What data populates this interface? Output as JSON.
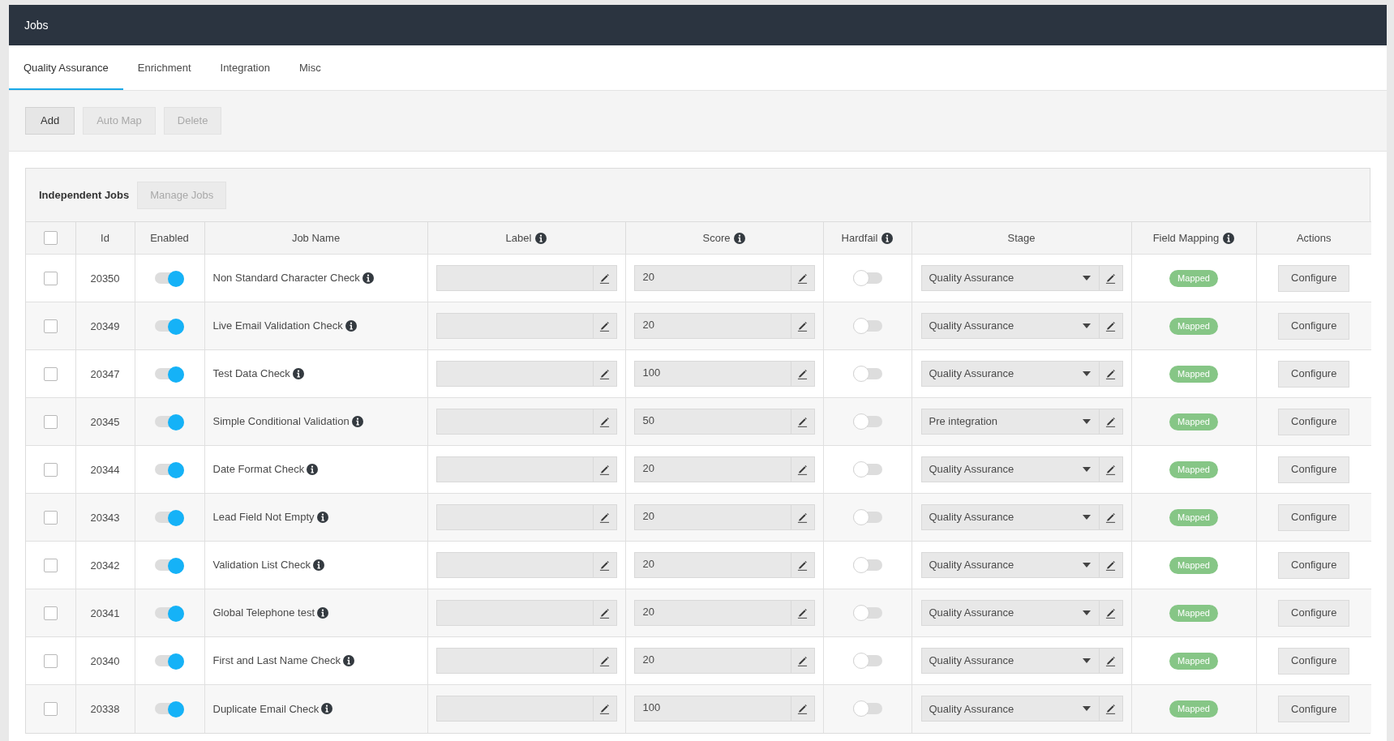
{
  "header": {
    "title": "Jobs"
  },
  "tabs": [
    {
      "label": "Quality Assurance",
      "selected": true
    },
    {
      "label": "Enrichment",
      "selected": false
    },
    {
      "label": "Integration",
      "selected": false
    },
    {
      "label": "Misc",
      "selected": false
    }
  ],
  "toolbar": {
    "buttons": [
      {
        "label": "Add",
        "disabled": false
      },
      {
        "label": "Auto Map",
        "disabled": true
      },
      {
        "label": "Delete",
        "disabled": true
      }
    ]
  },
  "panel": {
    "title": "Independent Jobs",
    "manage_button": {
      "label": "Manage Jobs",
      "disabled": true
    }
  },
  "table": {
    "select_all": {
      "checked": false
    },
    "columns": [
      {
        "label": "Id",
        "info": false
      },
      {
        "label": "Enabled",
        "info": false
      },
      {
        "label": "Job Name",
        "info": false
      },
      {
        "label": "Label",
        "info": true
      },
      {
        "label": "Score",
        "info": true
      },
      {
        "label": "Hardfail",
        "info": true
      },
      {
        "label": "Stage",
        "info": false
      },
      {
        "label": "Field Mapping",
        "info": true
      },
      {
        "label": "Actions",
        "info": false
      }
    ],
    "rows": [
      {
        "checked": false,
        "id": "20350",
        "enabled": true,
        "job_name": "Non Standard Character Check",
        "score": "20",
        "hardfail": false,
        "stage": "Quality Assurance",
        "field_mapping": "Mapped",
        "action": "Configure"
      },
      {
        "checked": false,
        "id": "20349",
        "enabled": true,
        "job_name": "Live Email Validation Check",
        "score": "20",
        "hardfail": false,
        "stage": "Quality Assurance",
        "field_mapping": "Mapped",
        "action": "Configure"
      },
      {
        "checked": false,
        "id": "20347",
        "enabled": true,
        "job_name": "Test Data Check",
        "score": "100",
        "hardfail": false,
        "stage": "Quality Assurance",
        "field_mapping": "Mapped",
        "action": "Configure"
      },
      {
        "checked": false,
        "id": "20345",
        "enabled": true,
        "job_name": "Simple Conditional Validation",
        "score": "50",
        "hardfail": false,
        "stage": "Pre integration",
        "field_mapping": "Mapped",
        "action": "Configure"
      },
      {
        "checked": false,
        "id": "20344",
        "enabled": true,
        "job_name": "Date Format Check",
        "score": "20",
        "hardfail": false,
        "stage": "Quality Assurance",
        "field_mapping": "Mapped",
        "action": "Configure"
      },
      {
        "checked": false,
        "id": "20343",
        "enabled": true,
        "job_name": "Lead Field Not Empty",
        "score": "20",
        "hardfail": false,
        "stage": "Quality Assurance",
        "field_mapping": "Mapped",
        "action": "Configure"
      },
      {
        "checked": false,
        "id": "20342",
        "enabled": true,
        "job_name": "Validation List Check",
        "score": "20",
        "hardfail": false,
        "stage": "Quality Assurance",
        "field_mapping": "Mapped",
        "action": "Configure"
      },
      {
        "checked": false,
        "id": "20341",
        "enabled": true,
        "job_name": "Global Telephone test",
        "score": "20",
        "hardfail": false,
        "stage": "Quality Assurance",
        "field_mapping": "Mapped",
        "action": "Configure"
      },
      {
        "checked": false,
        "id": "20340",
        "enabled": true,
        "job_name": "First and Last Name Check",
        "score": "20",
        "hardfail": false,
        "stage": "Quality Assurance",
        "field_mapping": "Mapped",
        "action": "Configure"
      },
      {
        "checked": false,
        "id": "20338",
        "enabled": true,
        "job_name": "Duplicate Email Check",
        "score": "100",
        "hardfail": false,
        "stage": "Quality Assurance",
        "field_mapping": "Mapped",
        "action": "Configure"
      }
    ]
  }
}
